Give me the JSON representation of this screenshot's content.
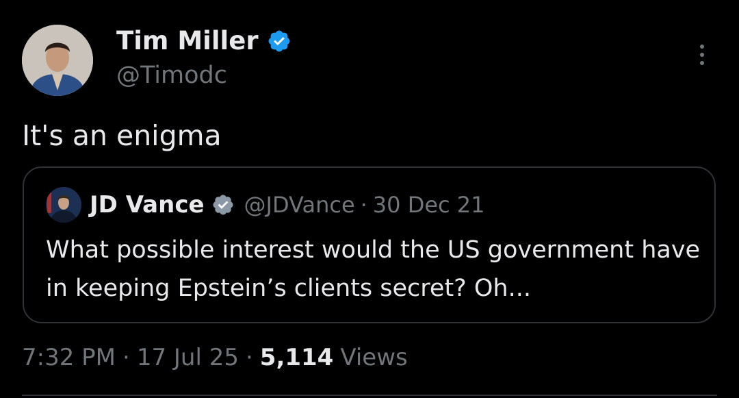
{
  "author": {
    "name": "Tim Miller",
    "handle": "@Timodc",
    "avatar_icon": "tim-miller-avatar",
    "verified_icon": "verified-badge-icon"
  },
  "tweet": {
    "text": "It's an enigma",
    "time": "7:32 PM",
    "date": "17 Jul 25",
    "views_count": "5,114",
    "views_label": "Views",
    "separator": "·"
  },
  "quoted_tweet": {
    "name": "JD Vance",
    "handle": "@JDVance",
    "separator": "·",
    "date": "30 Dec 21",
    "text": "What possible interest would the US government have in keeping Epstein’s clients secret? Oh...",
    "verified_icon": "verified-badge-icon"
  },
  "colors": {
    "background": "#000000",
    "primary_text": "#e7e9ea",
    "secondary_text": "#71767b",
    "verified_blue": "#1d9bf0",
    "border": "#2f3336"
  }
}
